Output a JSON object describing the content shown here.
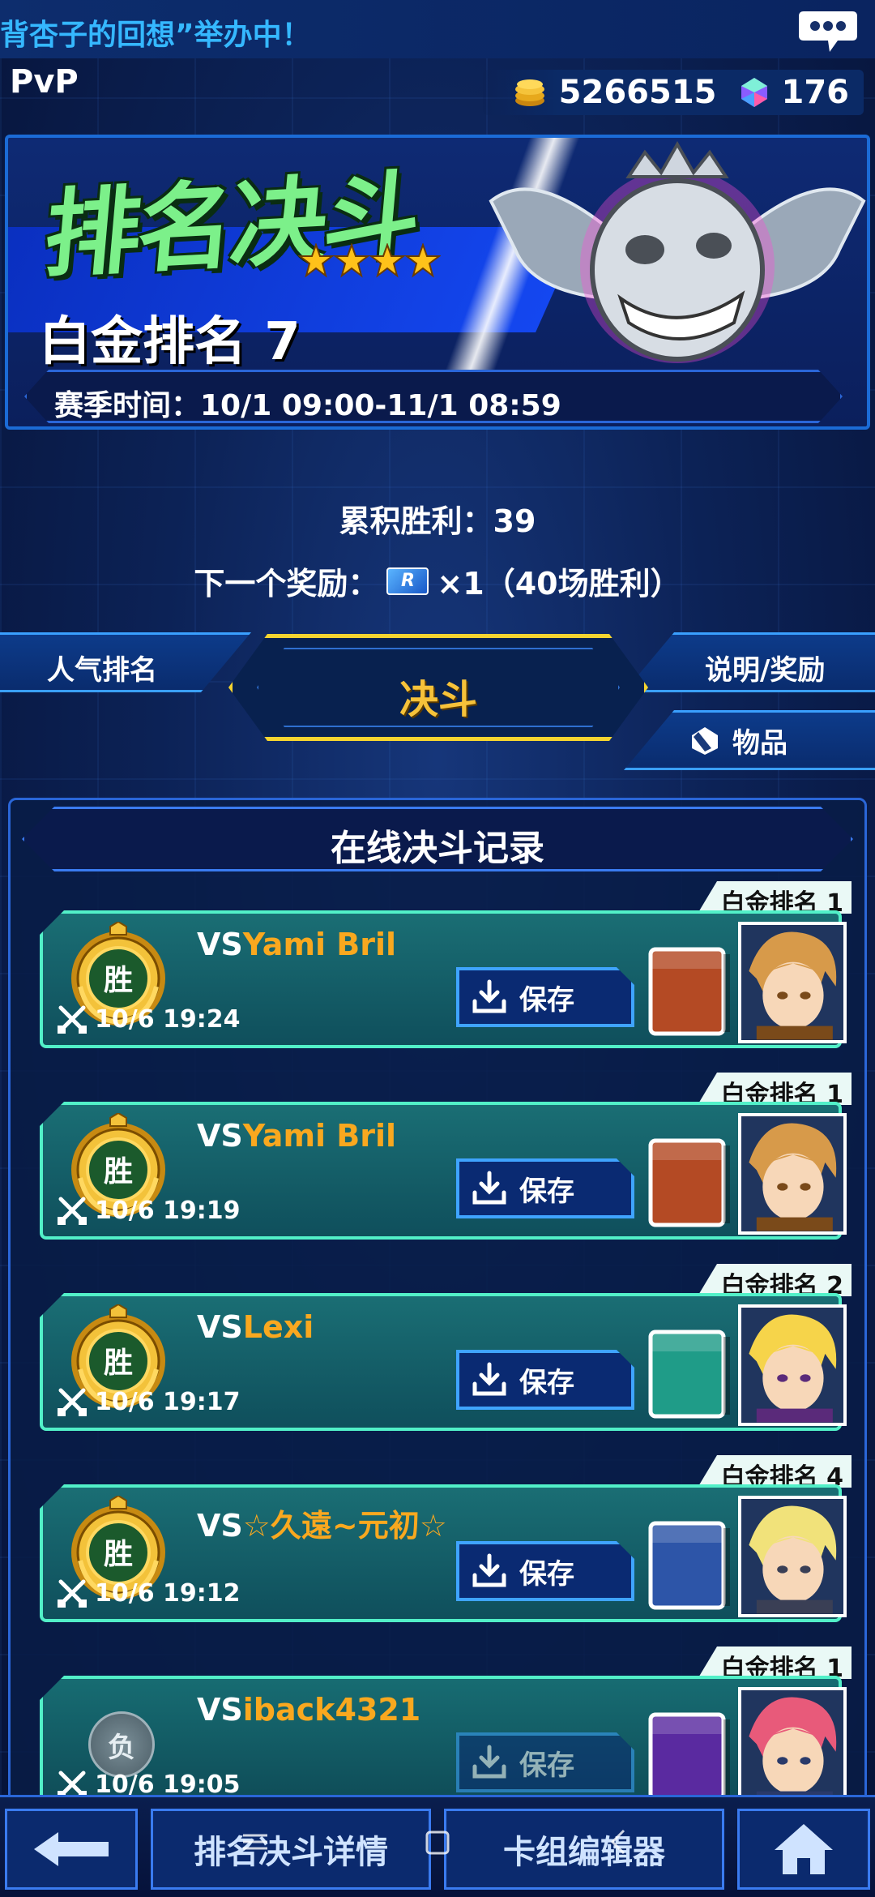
{
  "ticker": {
    "text": "背杏子的回想”举办中！"
  },
  "header": {
    "mode_label": "PvP",
    "coins": "5266515",
    "gems": "176"
  },
  "banner": {
    "title": "排名决斗",
    "stars": 4,
    "rank_name": "白金排名 7",
    "season_label": "赛季时间：10/1 09:00-11/1 08:59"
  },
  "stats": {
    "wins_label": "累积胜利：39",
    "next_reward_prefix": "下一个奖励：",
    "reward_ticket": "R",
    "next_reward_suffix": "×1（40场胜利）"
  },
  "tabs": {
    "left": "人气排名",
    "center": "决斗",
    "right": "说明/奖励",
    "items": "物品"
  },
  "records_panel": {
    "title": "在线决斗记录",
    "vs_prefix": "VS",
    "save_label": "保存",
    "records": [
      {
        "rank": "白金排名 1",
        "result": "胜",
        "opponent": "Yami Bril",
        "time": "10/6 19:24",
        "deck_color": "#b44a24",
        "avatar": "joey"
      },
      {
        "rank": "白金排名 1",
        "result": "胜",
        "opponent": "Yami Bril",
        "time": "10/6 19:19",
        "deck_color": "#b44a24",
        "avatar": "joey"
      },
      {
        "rank": "白金排名 2",
        "result": "胜",
        "opponent": "Lexi",
        "time": "10/6 19:17",
        "deck_color": "#1f9c88",
        "avatar": "yami"
      },
      {
        "rank": "白金排名 4",
        "result": "胜",
        "opponent": "☆久遠~元初☆",
        "time": "10/6 19:12",
        "deck_color": "#2d55a8",
        "avatar": "jack"
      },
      {
        "rank": "白金排名 1",
        "result": "负",
        "opponent": "iback4321",
        "time": "10/6 19:05",
        "deck_color": "#5a2aa0",
        "avatar": "yuma"
      }
    ]
  },
  "bottom_bar": {
    "back": "←",
    "details": "排名决斗详情",
    "deck_editor": "卡组编辑器",
    "home": "home"
  },
  "colors": {
    "accent_gold": "#f5d430",
    "opponent_name": "#f9a81f",
    "card_border": "#52f0c8"
  }
}
